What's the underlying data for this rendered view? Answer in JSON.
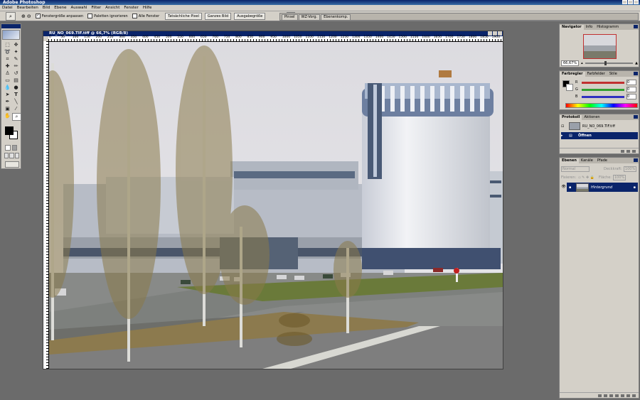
{
  "app": {
    "title": "Adobe Photoshop"
  },
  "menu": [
    "Datei",
    "Bearbeiten",
    "Bild",
    "Ebene",
    "Auswahl",
    "Filter",
    "Ansicht",
    "Fenster",
    "Hilfe"
  ],
  "options": {
    "checkboxes": [
      {
        "label": "Fenstergröße anpassen",
        "checked": true
      },
      {
        "label": "Paletten ignorieren",
        "checked": false
      },
      {
        "label": "Alle Fenster",
        "checked": false
      }
    ],
    "buttons": [
      "Tatsächliche Pixel",
      "Ganzes Bild",
      "Ausgabegröße"
    ]
  },
  "palette_well": [
    "Pinsel",
    "WZ-Vorg.",
    "Ebenenkomp."
  ],
  "document": {
    "title": "RU_NO_069.TIF.tiff @ 66,7% (RGB/8)",
    "ruler_labels": [
      "0",
      "50",
      "100",
      "150",
      "200",
      "250",
      "300",
      "350",
      "400",
      "450",
      "500",
      "550",
      "600",
      "650",
      "700",
      "750",
      "800",
      "850",
      "900",
      "950",
      "1000",
      "1050",
      "1100",
      "1150",
      "1200",
      "1250",
      "1300",
      "1350",
      "1400",
      "1450",
      "1500",
      "1550",
      "1600",
      "1650",
      "1700",
      "1750",
      "1800",
      "1850",
      "1900"
    ]
  },
  "navigator": {
    "tabs": [
      "Navigator",
      "Info",
      "Histogramm"
    ],
    "zoom": "66,67%"
  },
  "color": {
    "tabs": [
      "Farbregler",
      "Farbfelder",
      "Stile"
    ],
    "channels": [
      {
        "label": "R",
        "value": "0",
        "track": "#c03030"
      },
      {
        "label": "G",
        "value": "0",
        "track": "#30a030"
      },
      {
        "label": "B",
        "value": "0",
        "track": "#3030c0"
      }
    ]
  },
  "history": {
    "tabs": [
      "Protokoll",
      "Aktionen"
    ],
    "snapshot": "RU_NO_069.TIF.tiff",
    "items": [
      "Öffnen"
    ]
  },
  "layers": {
    "tabs": [
      "Ebenen",
      "Kanäle",
      "Pfade"
    ],
    "blend_mode": "Normal",
    "opacity_label": "Deckkraft:",
    "opacity": "100%",
    "lock_label": "Fixieren:",
    "fill_label": "Fläche:",
    "fill": "100%",
    "items": [
      "Hintergrund"
    ]
  },
  "colors": {
    "titlebar": "#0a246a",
    "panel": "#d4d0c8",
    "workspace": "#6b6b6b",
    "selected": "#0a246a"
  }
}
